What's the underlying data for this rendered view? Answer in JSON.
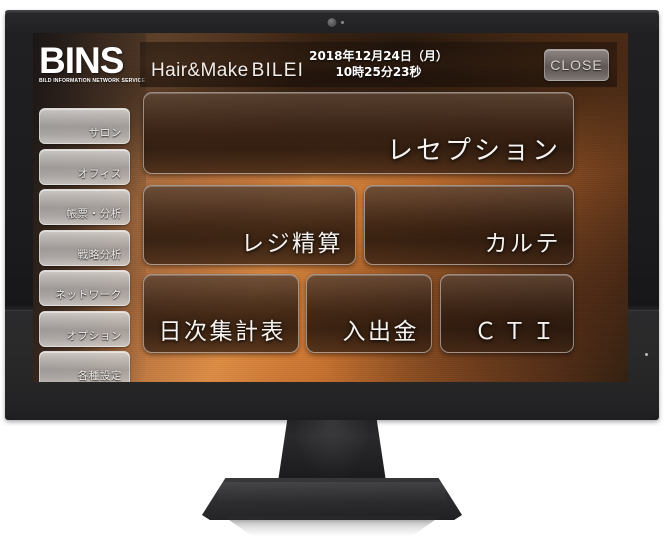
{
  "app": {
    "logo_word": "BINS",
    "logo_subtitle": "BILD INFORMATION NETWORK SERVICE"
  },
  "sidebar": {
    "items": [
      {
        "label": "サロン"
      },
      {
        "label": "オフィス"
      },
      {
        "label": "帳票・分析"
      },
      {
        "label": "戦略分析"
      },
      {
        "label": "ネットワーク"
      },
      {
        "label": "オプション"
      },
      {
        "label": "各種設定"
      }
    ]
  },
  "header": {
    "shop_name": "Hair&Make",
    "shop_brand": "BILEI",
    "date": "2018年12月24日（月）",
    "time": "10時25分23秒",
    "close_label": "CLOSE"
  },
  "main": {
    "tiles": [
      {
        "label": "レセプション"
      },
      {
        "label": "レジ精算"
      },
      {
        "label": "カルテ"
      },
      {
        "label": "日次集計表"
      },
      {
        "label": "入出金"
      },
      {
        "label": "ＣＴＩ"
      }
    ]
  },
  "colors": {
    "accent_copper": "#c1702f",
    "accent_orange": "#d4873f",
    "tile_dark": "#2f1c10",
    "bezel": "#1b1b1d",
    "text_light": "#f6f2ef"
  }
}
